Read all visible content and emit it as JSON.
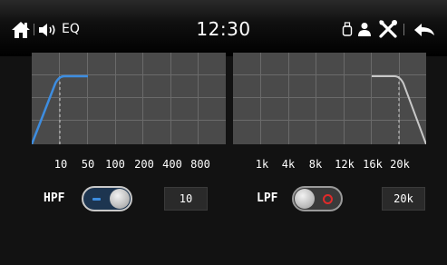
{
  "status_bar": {
    "eq_label": "EQ",
    "clock": "12:30",
    "icons": [
      "home-icon",
      "volume-icon",
      "usb-icon",
      "user-icon",
      "tools-icon",
      "back-arrow-icon"
    ]
  },
  "hpf": {
    "label": "HPF",
    "enabled": true,
    "value": "10",
    "freq_labels": [
      "10",
      "50",
      "100",
      "200",
      "400",
      "800"
    ]
  },
  "lpf": {
    "label": "LPF",
    "enabled": false,
    "value": "20k",
    "freq_labels": [
      "1k",
      "4k",
      "8k",
      "12k",
      "16k",
      "20k"
    ]
  },
  "colors": {
    "accent": "#3d8de0",
    "panel": "#4a4a4a",
    "grid": "#6a6a6a",
    "lpf_curve": "#c8c8c8",
    "off_indicator": "#e02a2a"
  }
}
